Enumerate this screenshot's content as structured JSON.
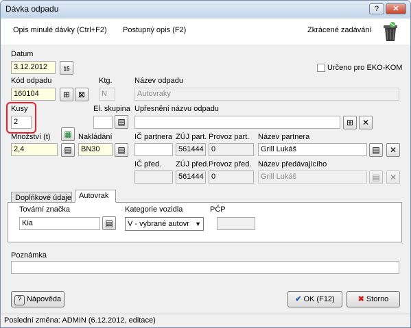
{
  "window": {
    "title": "Dávka odpadu",
    "help_btn": "?",
    "close_btn": "✕"
  },
  "toolbar": {
    "opis_minule": "Opis minulé dávky (Ctrl+F2)",
    "postupny_opis": "Postupný opis (F2)",
    "zkracene": "Zkrácené zadávání"
  },
  "form": {
    "datum_label": "Datum",
    "datum_value": "3.12.2012",
    "eko_kom_label": "Určeno pro EKO-KOM",
    "kod_label": "Kód odpadu",
    "kod_value": "160104",
    "ktg_label": "Ktg.",
    "ktg_value": "N",
    "nazev_label": "Název odpadu",
    "nazev_value": "Autovraky",
    "kusy_label": "Kusy",
    "kusy_value": "2",
    "el_skupina_label": "El. skupina",
    "upresneni_label": "Upřesnění názvu odpadu",
    "upresneni_value": "",
    "mnozstvi_label": "Množství (t)",
    "mnozstvi_value": "2,4",
    "nakladani_label": "Nakládání",
    "nakladani_value": "BN30",
    "ic_partnera_label": "IČ partnera",
    "ic_partnera_value": "",
    "zuj_part_label": "ZÚJ part.",
    "zuj_part_value": "561444",
    "provoz_part_label": "Provoz part.",
    "provoz_part_value": "0",
    "nazev_partnera_label": "Název partnera",
    "nazev_partnera_value": "Grill Lukáš",
    "ic_pred_label": "IČ před.",
    "ic_pred_value": "",
    "zuj_pred_label": "ZÚJ před.",
    "zuj_pred_value": "561444",
    "provoz_pred_label": "Provoz před.",
    "provoz_pred_value": "0",
    "nazev_pred_label": "Název předávajícího",
    "nazev_pred_value": "Grill Lukáš"
  },
  "tabs": [
    {
      "label": "Doplňkové údaje"
    },
    {
      "label": "Autovrak"
    }
  ],
  "autovrak": {
    "tovarni_label": "Tovární značka",
    "tovarni_value": "Kia",
    "kategorie_label": "Kategorie vozidla",
    "kategorie_value": "V - vybrané autovr",
    "pcp_label": "PČP",
    "pcp_value": ""
  },
  "poznamka": {
    "label": "Poznámka",
    "value": ""
  },
  "buttons": {
    "napoveda": "Nápověda",
    "ok": "OK (F12)",
    "storno": "Storno"
  },
  "status": {
    "text": "Poslední změna: ADMIN (6.12.2012, editace)"
  },
  "colors": {
    "required_bg": "#ffffe1",
    "highlight": "#e8202a"
  }
}
